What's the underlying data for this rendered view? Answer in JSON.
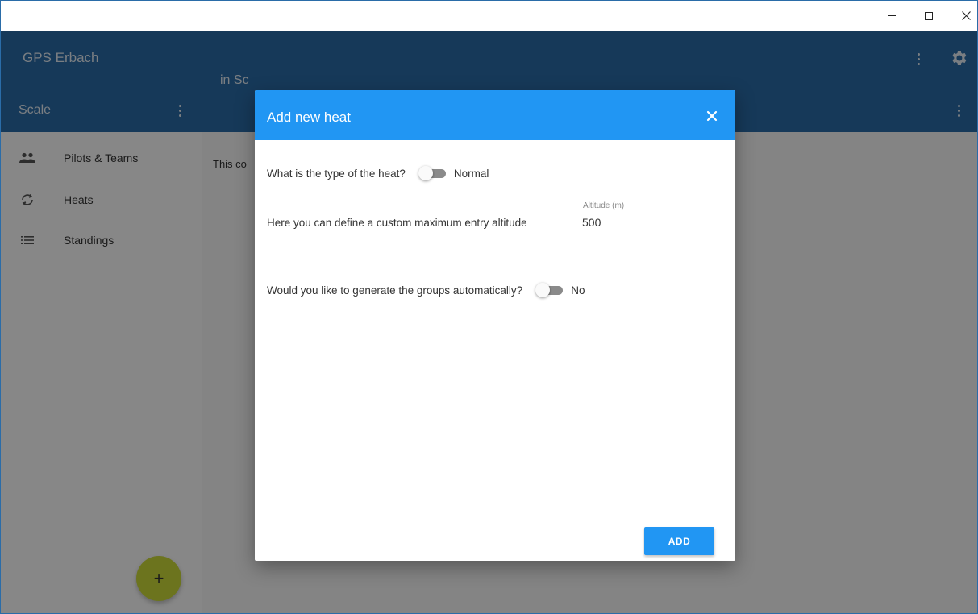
{
  "window": {
    "controls": {
      "minimize": "minimize",
      "maximize": "maximize",
      "close": "close"
    }
  },
  "appbar": {
    "title": "GPS Erbach",
    "left_column_title": "Scale",
    "right_column_title": "in Sc",
    "icons": [
      "more-vert-icon",
      "gear-icon"
    ],
    "color": "#2a6ca8"
  },
  "sidebar": {
    "items": [
      {
        "label": "Pilots & Teams",
        "icon": "people-icon"
      },
      {
        "label": "Heats",
        "icon": "sync-icon"
      },
      {
        "label": "Standings",
        "icon": "list-icon"
      }
    ],
    "fab_label": "+",
    "fab_color": "#cddc39"
  },
  "content": {
    "text": "This co"
  },
  "dialog": {
    "title": "Add new heat",
    "header_color": "#2196f3",
    "questions": {
      "heat_type": {
        "label": "What is the type of the heat?",
        "value": "Normal"
      },
      "altitude": {
        "label": "Here you can define a custom maximum entry altitude",
        "field_label": "Altitude (m)",
        "value": "500"
      },
      "auto_groups": {
        "label": "Would you like to generate the groups automatically?",
        "value": "No"
      }
    },
    "add_label": "ADD"
  }
}
